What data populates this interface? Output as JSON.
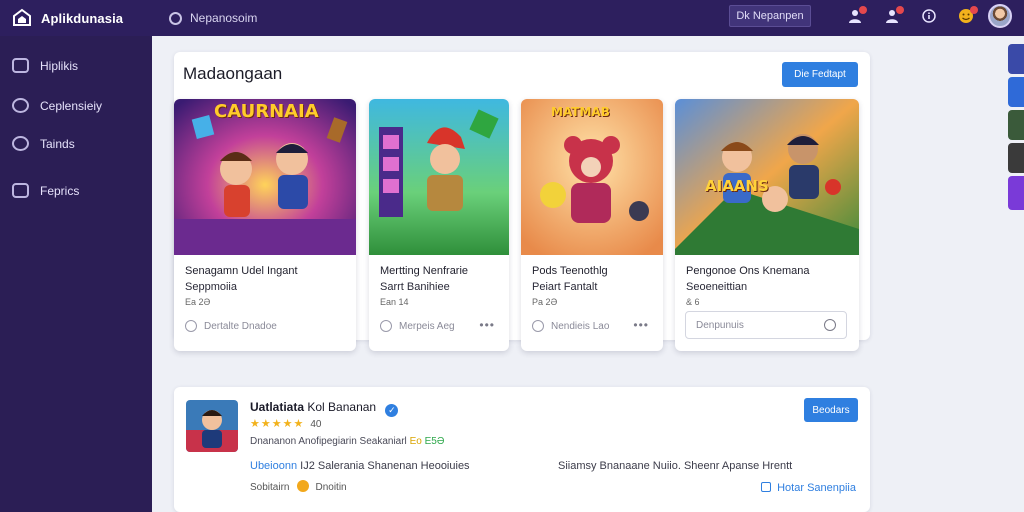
{
  "app": {
    "name": "Aplikdunasia",
    "search_label": "Nepanosoim"
  },
  "topbar": {
    "button_label": "Dk Nepanpen"
  },
  "sidebar": {
    "items": [
      {
        "label": "Hiplikis",
        "icon": "layers-icon"
      },
      {
        "label": "Ceplensieiy",
        "icon": "compass-icon"
      },
      {
        "label": "Tainds",
        "icon": "trend-icon"
      },
      {
        "label": "Feprics",
        "icon": "grid-icon"
      }
    ]
  },
  "section": {
    "title": "Madaongaan",
    "action_label": "Die Fedtapt",
    "games": [
      {
        "art_text": "CAURNAIA",
        "title": "Senagamn Udel Ingant",
        "subtitle": "Seppmoiia",
        "meta": "Ea 2Ə",
        "footer": "Dertalte Dnadoe"
      },
      {
        "art_text": "",
        "title": "Mertting Nenfrarie",
        "subtitle": "Sarrt Banihiee",
        "meta": "Ean 14",
        "footer": "Merpeis Aeg"
      },
      {
        "art_text": "MATMAB",
        "title": "Pods Teenothlg",
        "subtitle": "Peiart Fantalt",
        "meta": "Pa 2Ə",
        "footer": "Nendieis Lao"
      },
      {
        "art_text": "AIAANS",
        "title": "Pengonoe Ons Knemana",
        "subtitle": "Seoeneittian",
        "meta": "& 6",
        "footer": "Denpunuis"
      }
    ]
  },
  "featured": {
    "name": "Uatlatiata",
    "name_suffix": "Kol Bananan",
    "stars": "★★★★★",
    "rating_count": "40",
    "description": "Dnananon Anofipegiarin Seakaniarl",
    "tag1": "Eo",
    "tag2": "E5Ə",
    "link_text": "Ubeioonn",
    "detail_left": "IJ2 Salerania Shanenan Heooiuies",
    "detail_right": "Siiamsy Bnanaane Nuiio. Sheenr Apanse Hrentt",
    "footer_left": "Sobitairn",
    "footer_right": "Dnoitin",
    "install_label": "Beodars",
    "bottom_link": "Hotar Sanenpiia"
  }
}
